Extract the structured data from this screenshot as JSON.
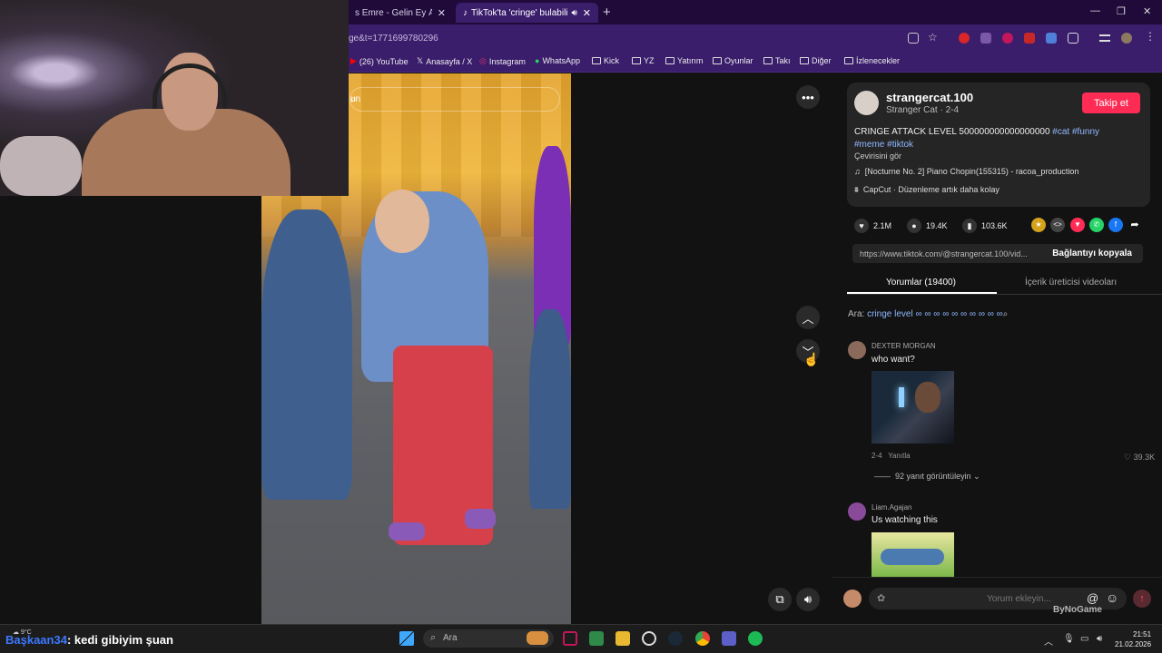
{
  "browser": {
    "tabs": [
      {
        "label": "s Emre - Gelin Ey Âşıklar |"
      },
      {
        "label": "TikTok'ta 'cringe' bulabilirsi"
      }
    ],
    "url": "ge&t=1771699780296",
    "bookmarks": [
      "(26) YouTube",
      "Anasayfa / X",
      "Instagram",
      "WhatsApp",
      "Kick",
      "YZ",
      "Yatırım",
      "Oyunlar",
      "Takı",
      "Diğer",
      "İzlenecekler"
    ]
  },
  "video": {
    "search_text": "un"
  },
  "post": {
    "username": "strangercat.100",
    "subtitle": "Stranger Cat · 2-4",
    "follow_label": "Takip et",
    "description": "CRINGE ATTACK LEVEL 500000000000000000",
    "hashtags": [
      "#cat",
      "#funny",
      "#meme",
      "#tiktok"
    ],
    "see_translation": "Çevirisini gör",
    "music": "[Nocturne No. 2] Piano Chopin(155315) - racoa_production",
    "capcut": "CapCut · Düzenleme artık daha kolay",
    "likes": "2.1M",
    "comments": "19.4K",
    "saves": "103.6K",
    "share_url": "https://www.tiktok.com/@strangercat.100/vid...",
    "copy_link": "Bağlantıyı kopyala"
  },
  "panel": {
    "tab_comments": "Yorumlar (19400)",
    "tab_creator": "İçerik üreticisi videoları",
    "search_prefix": "Ara:",
    "search_query": "cringe level ∞ ∞ ∞ ∞ ∞ ∞ ∞ ∞ ∞ ∞"
  },
  "comments": [
    {
      "name": "DEXTER MORGAN",
      "text": "who want?",
      "date": "2-4",
      "reply": "Yanıtla",
      "likes": "39.3K",
      "replies": "92 yanıt görüntüleyin"
    },
    {
      "name": "Liam.Agajan",
      "text": "Us watching this"
    }
  ],
  "comment_input": {
    "placeholder": "Yorum ekleyin..."
  },
  "overlay": {
    "brand": "ByNoGame"
  },
  "taskbar": {
    "chat_user": "Başkaan34",
    "chat_msg": ": kedi gibiyim şuan",
    "weather": "9°C",
    "search": "Ara",
    "time": "21:51",
    "date": "21.02.2026"
  }
}
